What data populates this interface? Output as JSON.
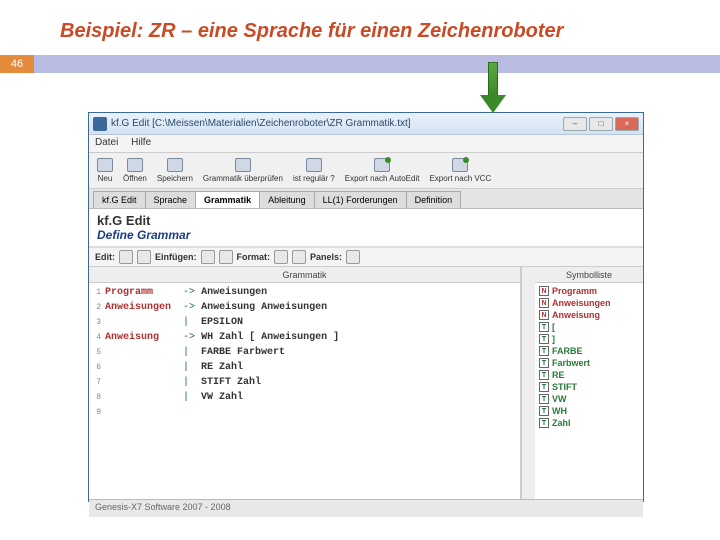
{
  "slide": {
    "title": "Beispiel:  ZR – eine Sprache für einen Zeichenroboter",
    "page": "46"
  },
  "window": {
    "title": "kf.G Edit  [C:\\Meissen\\Materialien\\Zeichenroboter\\ZR Grammatik.txt]",
    "menu": {
      "datei": "Datei",
      "hilfe": "Hilfe"
    },
    "toolbar": {
      "neu": "Neu",
      "oeffnen": "Öffnen",
      "speichern": "Speichern",
      "grammatik": "Grammatik überprüfen",
      "regular": "ist regulär ?",
      "export_auto": "Export nach AutoEdit",
      "export_vcc": "Export nach VCC"
    },
    "tabs": [
      "kf.G Edit",
      "Sprache",
      "Grammatik",
      "Ableitung",
      "LL(1) Forderungen",
      "Definition"
    ],
    "subheader": {
      "brand": "kf.G Edit",
      "define": "Define Grammar"
    },
    "editbar": {
      "edit": "Edit:",
      "einfuegen": "Einfügen:",
      "format": "Format:",
      "panels": "Panels:"
    }
  },
  "grammar": {
    "header": "Grammatik",
    "lines": [
      {
        "n": "1",
        "lhs": "Programm",
        "sep": "->",
        "rhs": "Anweisungen"
      },
      {
        "n": "2",
        "lhs": "Anweisungen",
        "sep": "->",
        "rhs": "Anweisung Anweisungen"
      },
      {
        "n": "3",
        "lhs": "",
        "sep": "| ",
        "rhs": "EPSILON"
      },
      {
        "n": "4",
        "lhs": "Anweisung",
        "sep": "->",
        "rhs": "WH Zahl [ Anweisungen ]"
      },
      {
        "n": "5",
        "lhs": "",
        "sep": "| ",
        "rhs": "FARBE Farbwert"
      },
      {
        "n": "6",
        "lhs": "",
        "sep": "| ",
        "rhs": "RE Zahl"
      },
      {
        "n": "7",
        "lhs": "",
        "sep": "| ",
        "rhs": "STIFT Zahl"
      },
      {
        "n": "8",
        "lhs": "",
        "sep": "| ",
        "rhs": "VW Zahl"
      },
      {
        "n": "9",
        "lhs": "",
        "sep": "",
        "rhs": ""
      }
    ]
  },
  "symbols": {
    "header": "Symbolliste",
    "items": [
      {
        "k": "N",
        "name": "Programm"
      },
      {
        "k": "N",
        "name": "Anweisungen"
      },
      {
        "k": "N",
        "name": "Anweisung"
      },
      {
        "k": "T",
        "name": "["
      },
      {
        "k": "T",
        "name": "]"
      },
      {
        "k": "T",
        "name": "FARBE"
      },
      {
        "k": "T",
        "name": "Farbwert"
      },
      {
        "k": "T",
        "name": "RE"
      },
      {
        "k": "T",
        "name": "STIFT"
      },
      {
        "k": "T",
        "name": "VW"
      },
      {
        "k": "T",
        "name": "WH"
      },
      {
        "k": "T",
        "name": "Zahl"
      }
    ]
  },
  "status": "Genesis-X7 Software 2007 - 2008"
}
